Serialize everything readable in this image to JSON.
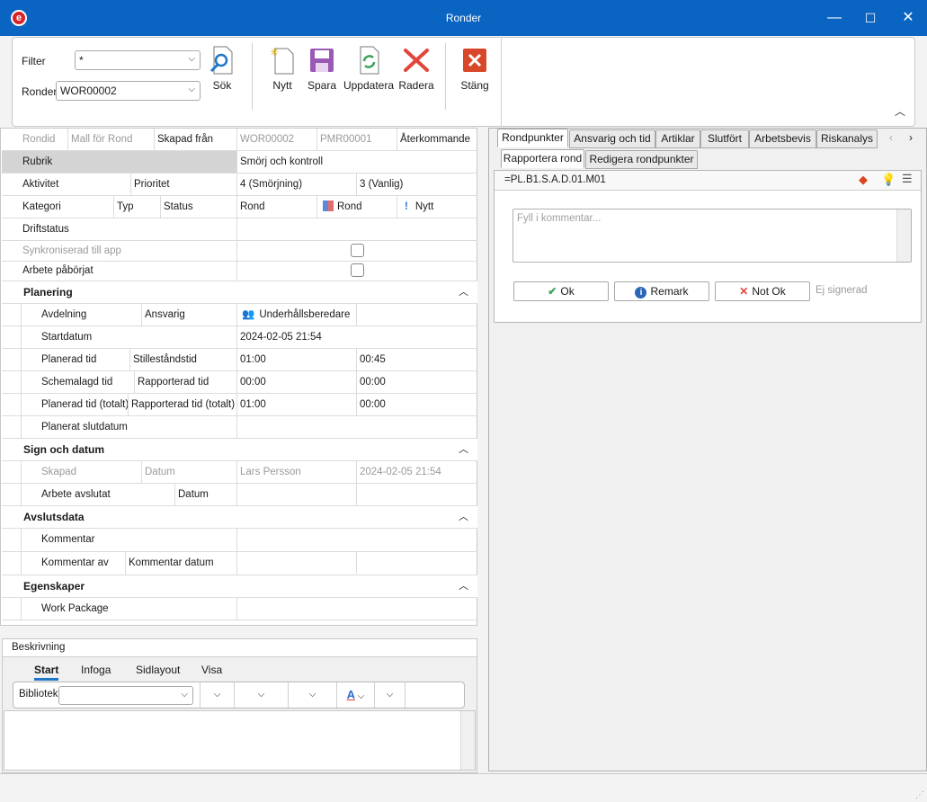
{
  "window": {
    "title": "Ronder",
    "minimize": "—",
    "maximize": "☐",
    "close": "✕"
  },
  "toolbar": {
    "filter_label": "Filter",
    "filter_value": "*",
    "ronder_label": "Ronder",
    "ronder_value": "WOR00002",
    "search": "Sök",
    "new": "Nytt",
    "save": "Spara",
    "refresh": "Uppdatera",
    "delete": "Radera",
    "close": "Stäng"
  },
  "form": {
    "rondid_label": "Rondid",
    "mall_label": "Mall för Rond",
    "skapad_fran_label": "Skapad från",
    "rondid_value": "WOR00002",
    "mall_value": "PMR00001",
    "skapad_fran_value": "Återkommande",
    "rubrik_label": "Rubrik",
    "rubrik_value": "Smörj och kontroll",
    "aktivitet_label": "Aktivitet",
    "prioritet_label": "Prioritet",
    "aktivitet_value": "4 (Smörjning)",
    "prioritet_value": "3 (Vanlig)",
    "kategori_label": "Kategori",
    "typ_label": "Typ",
    "status_label": "Status",
    "kategori_value": "Rond",
    "typ_value": "Rond",
    "status_value": "Nytt",
    "driftstatus_label": "Driftstatus",
    "synk_label": "Synkroniserad till app",
    "arbete_paborjat_label": "Arbete påbörjat"
  },
  "planering": {
    "title": "Planering",
    "avdelning_label": "Avdelning",
    "ansvarig_label": "Ansvarig",
    "ansvarig_value": "Underhållsberedare",
    "startdatum_label": "Startdatum",
    "startdatum_value": "2024-02-05 21:54",
    "planerad_tid_label": "Planerad tid",
    "stillestandstid_label": "Stilleståndstid",
    "planerad_tid_value": "01:00",
    "stillestandstid_value": "00:45",
    "schemalagd_label": "Schemalagd tid",
    "rapporterad_label": "Rapporterad tid",
    "schemalagd_value": "00:00",
    "rapporterad_value": "00:00",
    "planerad_totalt_label": "Planerad tid (totalt)",
    "rapporterad_totalt_label": "Rapporterad tid (totalt)",
    "planerad_totalt_value": "01:00",
    "rapporterad_totalt_value": "00:00",
    "slutdatum_label": "Planerat slutdatum"
  },
  "sign": {
    "title": "Sign och datum",
    "skapad_label": "Skapad",
    "datum_label": "Datum",
    "skapad_value": "Lars Persson",
    "datum_value": "2024-02-05 21:54",
    "arbete_avslutat_label": "Arbete avslutat",
    "datum2_label": "Datum"
  },
  "avslut": {
    "title": "Avslutsdata",
    "kommentar_label": "Kommentar",
    "kommentar_av_label": "Kommentar av",
    "kommentar_datum_label": "Kommentar datum"
  },
  "egenskaper": {
    "title": "Egenskaper",
    "work_package_label": "Work Package"
  },
  "beskrivning": {
    "title": "Beskrivning",
    "tabs": [
      "Start",
      "Infoga",
      "Sidlayout",
      "Visa"
    ],
    "bibliotek_label": "Bibliotek"
  },
  "right": {
    "tabs": [
      "Rondpunkter",
      "Ansvarig och tid",
      "Artiklar",
      "Slutfört",
      "Arbetsbevis",
      "Riskanalys"
    ],
    "subtabs": [
      "Rapportera rond",
      "Redigera rondpunkter"
    ],
    "point_id": "=PL.B1.S.A.D.01.M01",
    "comment_placeholder": "Fyll i kommentar...",
    "ok": "Ok",
    "remark": "Remark",
    "not_ok": "Not Ok",
    "ej_signerad": "Ej signerad"
  },
  "colors": {
    "titlebar": "#0a64c2",
    "accent_red": "#d8232a",
    "save_purple": "#9b59b6"
  }
}
